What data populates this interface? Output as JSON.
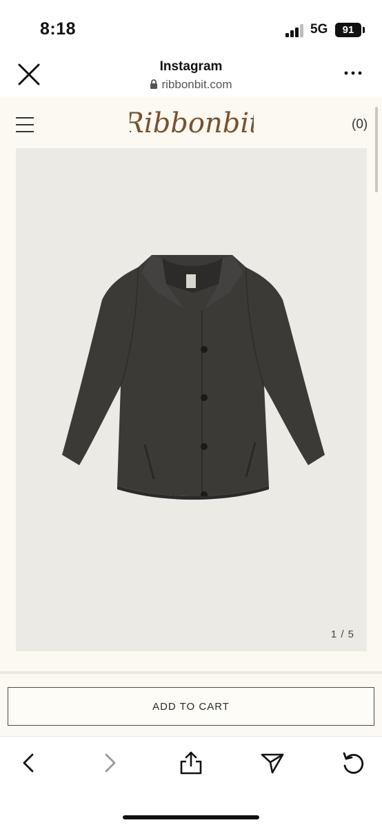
{
  "status_bar": {
    "time": "8:18",
    "network": "5G",
    "battery": "91"
  },
  "browser": {
    "title": "Instagram",
    "url": "ribbonbit.com",
    "icons": [
      "close-icon",
      "lock-icon",
      "more-icon"
    ]
  },
  "site": {
    "logo_text": "Ribbonbit",
    "cart_count": "(0)",
    "image_counter": "1 / 5",
    "add_to_cart_label": "ADD TO CART",
    "logo_color": "#7a5130",
    "background_color": "#fbf9f1"
  },
  "toolbar": {
    "icons": [
      "back-icon",
      "forward-icon",
      "share-icon",
      "send-icon",
      "reload-icon"
    ]
  }
}
